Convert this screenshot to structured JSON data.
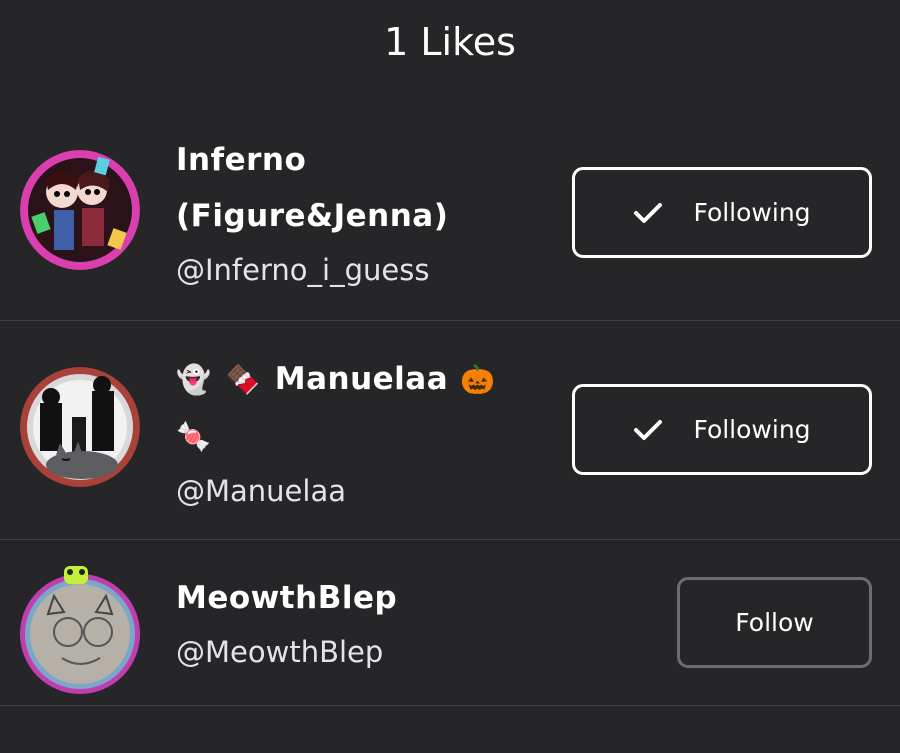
{
  "header": {
    "title": "1 Likes"
  },
  "users": [
    {
      "display_name_line1": "Inferno",
      "display_name_line2": "(Figure&Jenna)",
      "username": "@Inferno_i_guess",
      "button_label": "Following",
      "button_icon": "check-icon",
      "following": true,
      "avatar_ring_color": "#d93fae"
    },
    {
      "emoji_1": "👻",
      "emoji_2": "🍫",
      "display_name": "Manuelaa",
      "emoji_3": "🎃",
      "emoji_4": "🍬",
      "username": "@Manuelaa",
      "button_label": "Following",
      "button_icon": "check-icon",
      "following": true,
      "avatar_ring_color": "#a8413a"
    },
    {
      "display_name": "MeowthBlep",
      "username": "@MeowthBlep",
      "button_label": "Follow",
      "following": false,
      "avatar_ring_color": "#c03fb0"
    }
  ],
  "colors": {
    "background": "#262528",
    "divider": "#3e3d41",
    "following_border": "#ffffff",
    "follow_border": "#6d6c70"
  }
}
